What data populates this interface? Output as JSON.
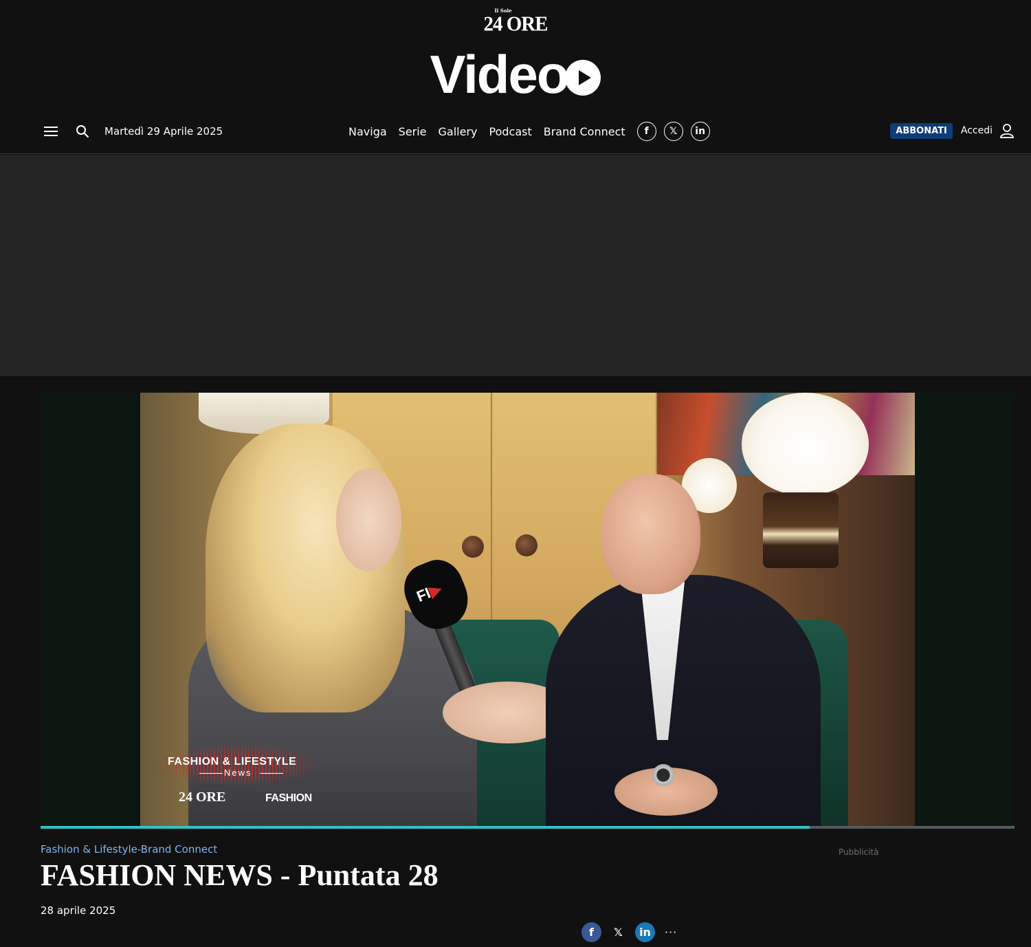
{
  "header": {
    "brand_small": "Il Sole",
    "brand_main": "24 ORE",
    "section_title": "Video",
    "date": "Martedì 29 Aprile 2025",
    "nav": [
      "Naviga",
      "Serie",
      "Gallery",
      "Podcast",
      "Brand Connect"
    ],
    "social": [
      {
        "name": "facebook-icon",
        "glyph": "f"
      },
      {
        "name": "x-icon",
        "glyph": "𝕏"
      },
      {
        "name": "linkedin-icon",
        "glyph": "in"
      }
    ],
    "subscribe_label": "ABBONATI",
    "login_label": "Accedi"
  },
  "player": {
    "overlay_title": "Fashion & Lifestyle",
    "overlay_subtitle": "News",
    "overlay_brand_left": "24 ORE",
    "overlay_brand_right": "FASHION",
    "mic_logo": "FI",
    "progress": 0.79
  },
  "article": {
    "category": "Fashion & Lifestyle-Brand Connect",
    "title": "FASHION NEWS - Puntata 28",
    "date": "28 aprile 2025",
    "ad_label": "Pubblicità"
  },
  "share": {
    "facebook": "f",
    "x": "𝕏",
    "linkedin": "in",
    "more": "···"
  },
  "colors": {
    "background": "#111111",
    "ad_band": "#242424",
    "accent_blue": "#0f3c7a",
    "category_blue": "#7fb5ef",
    "progress": "#2ec4c6"
  }
}
